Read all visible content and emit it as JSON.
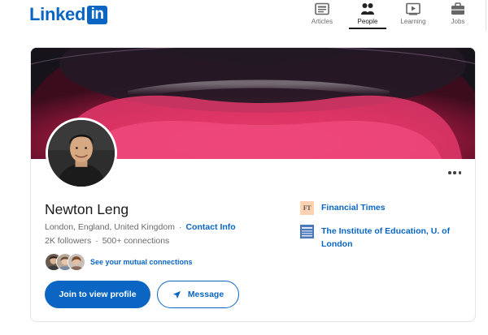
{
  "header": {
    "logo_text": "Linked",
    "logo_box": "in",
    "nav": [
      {
        "label": "Articles",
        "icon": "articles-icon"
      },
      {
        "label": "People",
        "icon": "people-icon",
        "active": true
      },
      {
        "label": "Learning",
        "icon": "learning-icon"
      },
      {
        "label": "Jobs",
        "icon": "jobs-icon"
      }
    ]
  },
  "profile": {
    "name": "Newton Leng",
    "location": "London, England, United Kingdom",
    "contact_info": "Contact Info",
    "followers": "2K followers",
    "connections": "500+ connections",
    "mutual_connections": "See your mutual connections",
    "separator": "·",
    "join_button": "Join to view profile",
    "message_button": "Message",
    "organizations": [
      {
        "name": "Financial Times",
        "logo_text": "FT"
      },
      {
        "name": "The Institute of Education, U. of London"
      }
    ]
  },
  "colors": {
    "brand": "#0a66c2",
    "cover_accent": "#d42a5a"
  }
}
